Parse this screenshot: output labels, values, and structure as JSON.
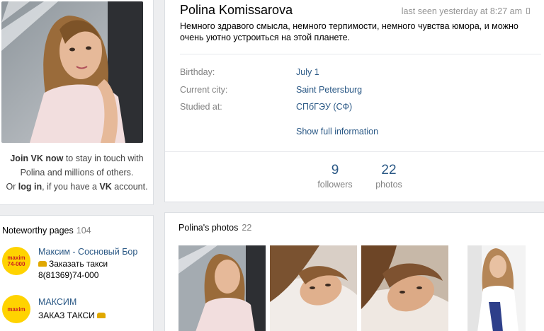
{
  "profile": {
    "name": "Polina Komissarova",
    "last_seen": "last seen yesterday at 8:27 am",
    "status": "Немного здравого смысла, немного терпимости, немного чувства юмора, и можно очень уютно устроиться на этой планете.",
    "info": [
      {
        "label": "Birthday:",
        "value": "July 1"
      },
      {
        "label": "Current city:",
        "value": "Saint Petersburg"
      },
      {
        "label": "Studied at:",
        "value": "СПбГЭУ (СФ)"
      }
    ],
    "show_full": "Show full information",
    "counters": [
      {
        "num": "9",
        "label": "followers"
      },
      {
        "num": "22",
        "label": "photos"
      }
    ]
  },
  "join": {
    "join_bold": "Join VK now",
    "line1_rest": " to stay in touch with",
    "line2": "Polina and millions of others.",
    "or": "Or ",
    "login": "log in",
    "if_you": ", if you have a ",
    "vk": "VK",
    "account": " account."
  },
  "noteworthy": {
    "title": "Noteworthy pages",
    "count": "104",
    "items": [
      {
        "logo_l1": "maxim",
        "logo_l2": "74-000",
        "name": "Максим - Сосновый Бор",
        "sub1": "Заказать такси",
        "sub2": "8(81369)74-000"
      },
      {
        "logo_l1": "maxim",
        "logo_l2": "",
        "name": "МАКСИМ",
        "sub1": "ЗАКАЗ ТАКСИ",
        "sub2": ""
      }
    ]
  },
  "photos": {
    "title": "Polina's photos",
    "count": "22"
  },
  "colors": {
    "link": "#2a5885",
    "muted": "#828282",
    "bg": "#edeef0",
    "logo_yellow": "#ffd300"
  }
}
